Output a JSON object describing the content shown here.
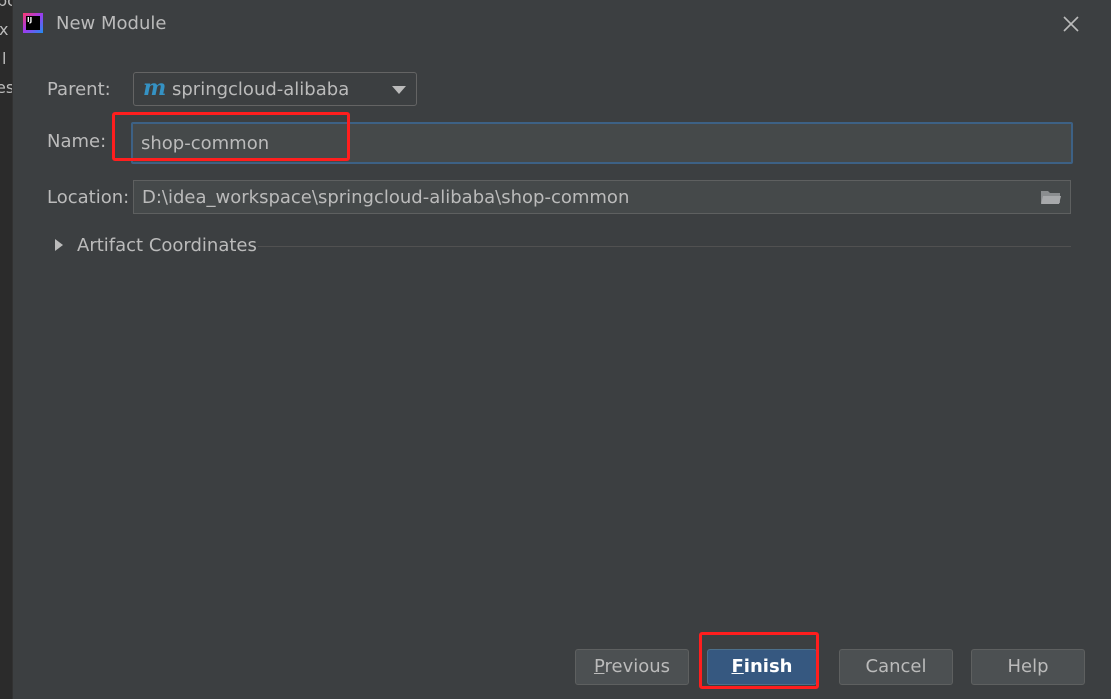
{
  "background_window": {
    "fragments": [
      "pom",
      "x",
      "l",
      "es"
    ]
  },
  "dialog": {
    "title": "New Module",
    "app_icon": "intellij-idea-icon",
    "close_icon": "close-icon"
  },
  "form": {
    "parent_label": "Parent:",
    "parent_value": "springcloud-alibaba",
    "parent_icon": "maven-icon",
    "name_label": "Name:",
    "name_value": "shop-common",
    "location_label": "Location:",
    "location_value": "D:\\idea_workspace\\springcloud-alibaba\\shop-common",
    "browse_icon": "folder-icon",
    "artifact_section": "Artifact Coordinates"
  },
  "buttons": {
    "previous_mnemonic": "P",
    "previous_rest": "revious",
    "finish_mnemonic": "F",
    "finish_rest": "inish",
    "cancel": "Cancel",
    "help": "Help"
  },
  "annotations": {
    "highlight_color": "#ff1e1e"
  }
}
